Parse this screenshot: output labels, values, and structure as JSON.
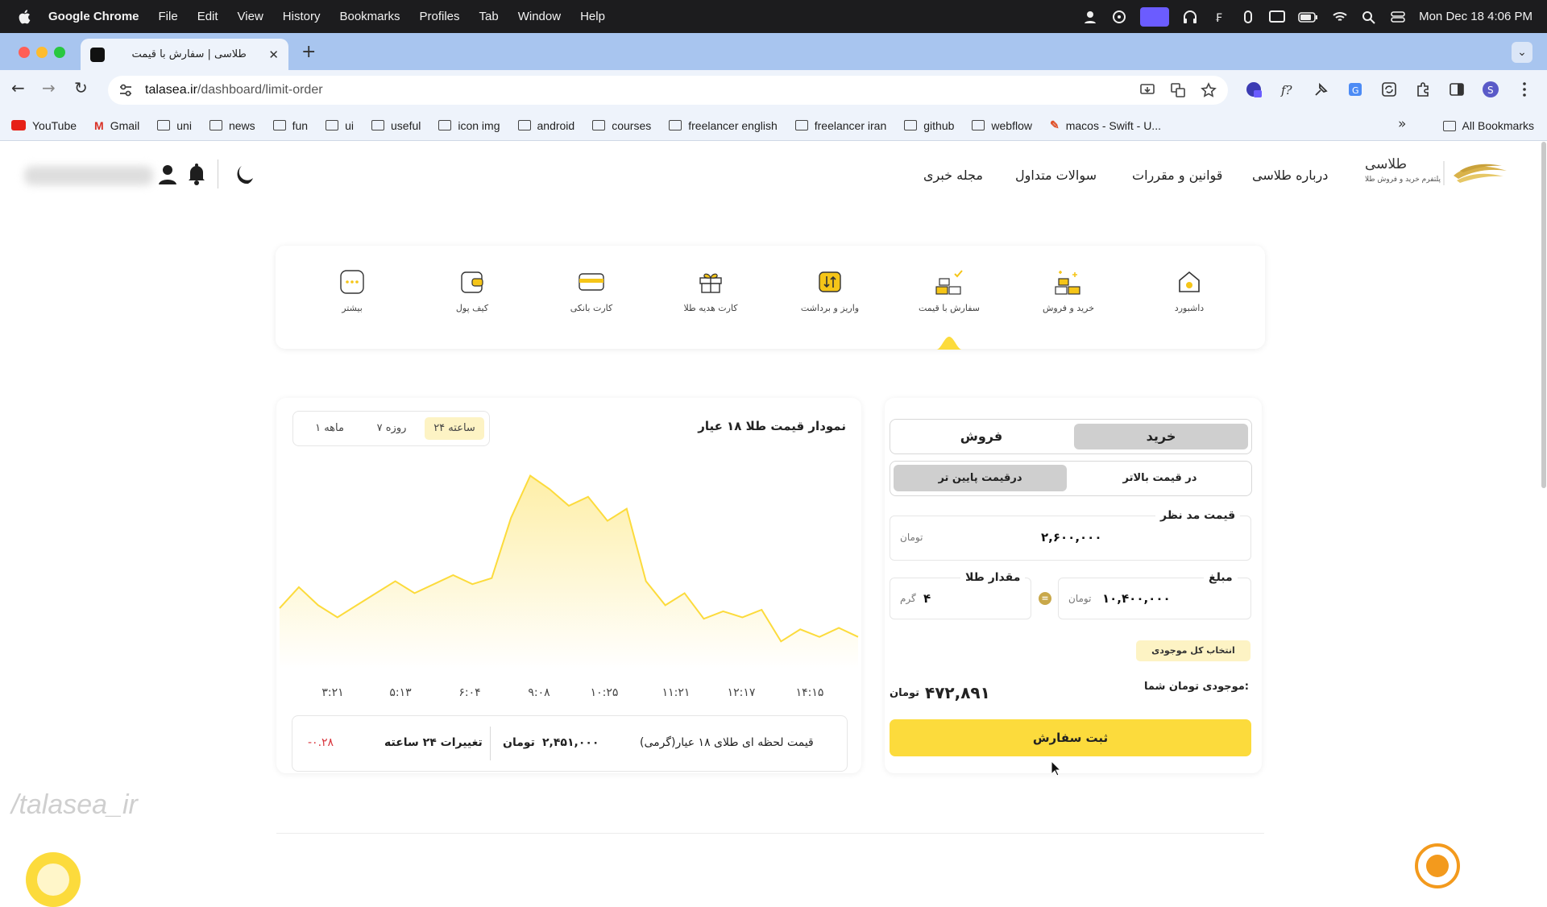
{
  "menubar": {
    "app": "Google Chrome",
    "items": [
      "File",
      "Edit",
      "View",
      "History",
      "Bookmarks",
      "Profiles",
      "Tab",
      "Window",
      "Help"
    ],
    "datetime": "Mon Dec 18  4:06 PM"
  },
  "browser": {
    "tab_title": "طلاسی | سفارش با قیمت",
    "url_host": "talasea.ir",
    "url_path": "/dashboard/limit-order",
    "bookmarks": [
      {
        "label": "YouTube",
        "type": "youtube"
      },
      {
        "label": "Gmail",
        "type": "gmail"
      },
      {
        "label": "uni",
        "type": "folder"
      },
      {
        "label": "news",
        "type": "folder"
      },
      {
        "label": "fun",
        "type": "folder"
      },
      {
        "label": "ui",
        "type": "folder"
      },
      {
        "label": "useful",
        "type": "folder"
      },
      {
        "label": "icon img",
        "type": "folder"
      },
      {
        "label": "android",
        "type": "folder"
      },
      {
        "label": "courses",
        "type": "folder"
      },
      {
        "label": "freelancer english",
        "type": "folder"
      },
      {
        "label": "freelancer iran",
        "type": "folder"
      },
      {
        "label": "github",
        "type": "folder"
      },
      {
        "label": "webflow",
        "type": "folder"
      },
      {
        "label": "macos - Swift - U...",
        "type": "link"
      }
    ],
    "more_bookmarks": "»",
    "all_bookmarks": "All Bookmarks"
  },
  "site": {
    "logo_name": "طلاسی",
    "logo_tagline": "پلتفرم خرید و فروش طلا",
    "nav": [
      "درباره طلاسی",
      "قوانین و مقررات",
      "سوالات متداول",
      "مجله خبری"
    ]
  },
  "services": [
    {
      "label": "داشبورد",
      "icon": "home-icon"
    },
    {
      "label": "خرید و فروش",
      "icon": "gold-bars-icon"
    },
    {
      "label": "سفارش با قیمت",
      "icon": "limit-order-icon",
      "active": true
    },
    {
      "label": "واریز و برداشت",
      "icon": "deposit-withdraw-icon"
    },
    {
      "label": "کارت هدیه طلا",
      "icon": "gift-icon"
    },
    {
      "label": "کارت بانکی",
      "icon": "bank-card-icon"
    },
    {
      "label": "کیف پول",
      "icon": "wallet-icon"
    },
    {
      "label": "بیشتر",
      "icon": "more-icon"
    }
  ],
  "order": {
    "buy": "خرید",
    "sell": "فروش",
    "higher": "در قیمت بالاتر",
    "lower": "درقیمت پایین تر",
    "target_price_label": "قیمت مد نظر",
    "target_price": "۲,۶۰۰,۰۰۰",
    "target_price_unit": "تومان",
    "amount_label": "مبلغ",
    "amount": "۱۰,۴۰۰,۰۰۰",
    "amount_unit": "تومان",
    "gold_label": "مقدار طلا",
    "gold": "۴",
    "gold_unit": "گرم",
    "select_all": "انتخاب کل موجودی",
    "balance_label": "موجودی تومان شما:",
    "balance": "۴۷۲,۸۹۱",
    "balance_unit": "تومان",
    "submit": "ثبت سفارش"
  },
  "chart": {
    "title": "نمودار قیمت طلا ۱۸ عیار",
    "ranges": [
      "۲۴ ساعته",
      "۷ روزه",
      "۱ ماهه"
    ],
    "active_range": 0,
    "live_price_label": "قیمت لحظه ای طلای ۱۸ عیار(گرمی)",
    "live_price": "۲,۴۵۱,۰۰۰",
    "live_price_unit": "تومان",
    "change_label": "تغییرات ۲۴ ساعته",
    "change": "-۰.۲۸",
    "change_color": "#d9363e",
    "accent": "#fcdb3c"
  },
  "chart_data": {
    "type": "area",
    "x_tick_labels": [
      "۳:۲۱",
      "۵:۱۳",
      "۶:۰۴",
      "۹:۰۸",
      "۱۰:۲۵",
      "۱۱:۲۱",
      "۱۲:۱۷",
      "۱۴:۱۵"
    ],
    "values": [
      60,
      74,
      62,
      54,
      62,
      70,
      78,
      70,
      76,
      82,
      76,
      80,
      120,
      148,
      139,
      128,
      134,
      118,
      126,
      78,
      62,
      70,
      53,
      58,
      54,
      59,
      38,
      46,
      41,
      47,
      41
    ],
    "ylim": [
      20,
      160
    ],
    "grid": false,
    "legend": "none"
  },
  "watermark": "/talasea_ir"
}
